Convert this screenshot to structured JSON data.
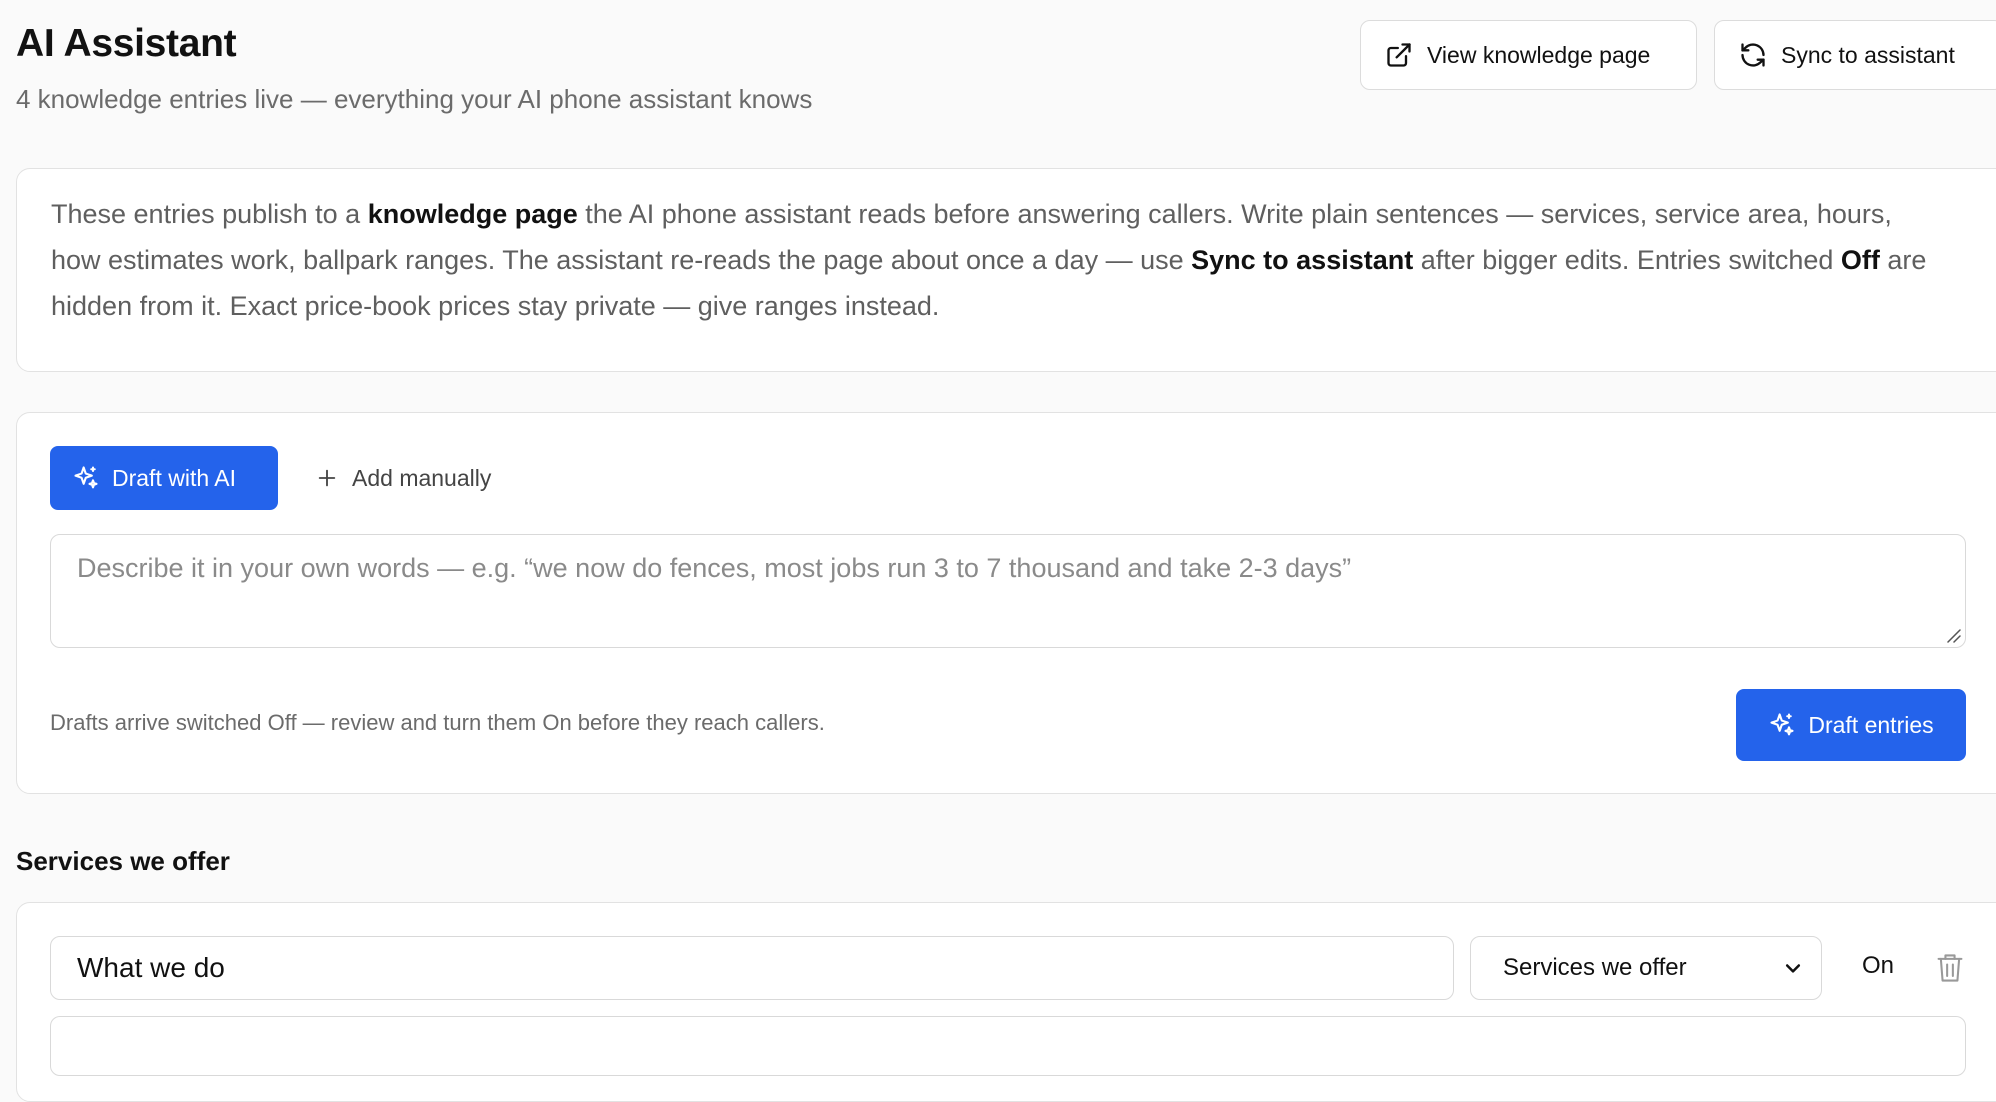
{
  "header": {
    "title": "AI Assistant",
    "subtitle": "4 knowledge entries live — everything your AI phone assistant knows",
    "view_button": "View knowledge page",
    "sync_button": "Sync to assistant"
  },
  "info": {
    "part1": "These entries publish to a ",
    "bold1": "knowledge page",
    "part2": " the AI phone assistant reads before answering callers. Write plain sentences — services, service area, hours, how estimates work, ballpark ranges. The assistant re-reads the page about once a day — use ",
    "bold2": "Sync to assistant",
    "part3": " after bigger edits. Entries switched ",
    "bold3": "Off",
    "part4": " are hidden from it. Exact price-book prices stay private — give ranges instead."
  },
  "draft": {
    "draft_ai_label": "Draft with AI",
    "add_manually_label": "Add manually",
    "placeholder": "Describe it in your own words — e.g. “we now do fences, most jobs run 3 to 7 thousand and take 2-3 days”",
    "hint": "Drafts arrive switched Off — review and turn them On before they reach callers.",
    "draft_entries_label": "Draft entries"
  },
  "section": {
    "title": "Services we offer"
  },
  "entry": {
    "title_value": "What we do",
    "category": "Services we offer",
    "toggle": "On"
  },
  "colors": {
    "accent": "#2463eb",
    "background": "#fafafa",
    "card": "#ffffff",
    "border": "#e2e2e2",
    "muted_text": "#6b6b6b"
  },
  "icons": {
    "view": "external-link-icon",
    "sync": "refresh-icon",
    "draft_ai": "sparkles-icon",
    "add": "plus-icon",
    "select": "chevron-down-icon",
    "delete": "trash-icon"
  }
}
